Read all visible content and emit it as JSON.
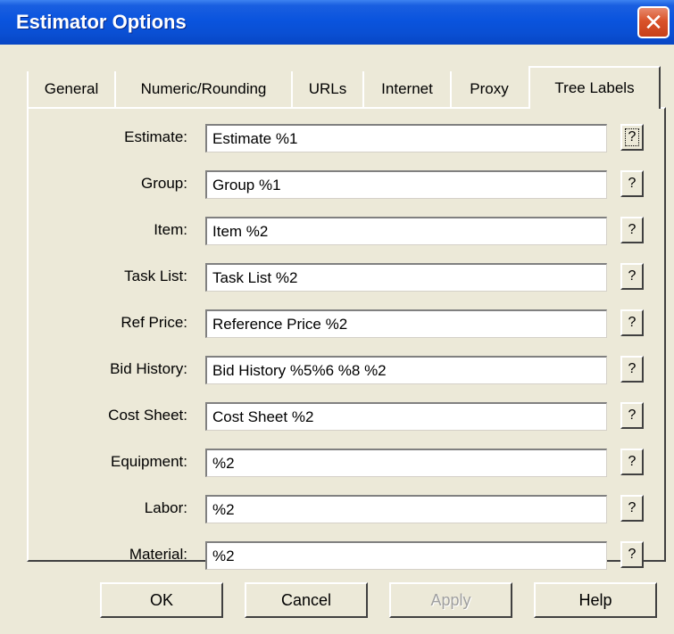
{
  "window": {
    "title": "Estimator Options",
    "close_glyph": "✕"
  },
  "tabs": [
    {
      "label": "General"
    },
    {
      "label": "Numeric/Rounding"
    },
    {
      "label": "URLs"
    },
    {
      "label": "Internet"
    },
    {
      "label": "Proxy"
    },
    {
      "label": "Tree Labels",
      "active": true
    }
  ],
  "fields": [
    {
      "label": "Estimate:",
      "value": "Estimate %1"
    },
    {
      "label": "Group:",
      "value": "Group %1"
    },
    {
      "label": "Item:",
      "value": "Item %2"
    },
    {
      "label": "Task List:",
      "value": "Task List %2"
    },
    {
      "label": "Ref Price:",
      "value": "Reference Price %2"
    },
    {
      "label": "Bid History:",
      "value": "Bid History %5%6 %8 %2"
    },
    {
      "label": "Cost Sheet:",
      "value": "Cost Sheet %2"
    },
    {
      "label": "Equipment:",
      "value": "%2"
    },
    {
      "label": "Labor:",
      "value": "%2"
    },
    {
      "label": "Material:",
      "value": "%2"
    }
  ],
  "help_button_label": "?",
  "buttons": {
    "ok": "OK",
    "cancel": "Cancel",
    "apply": "Apply",
    "help": "Help"
  }
}
